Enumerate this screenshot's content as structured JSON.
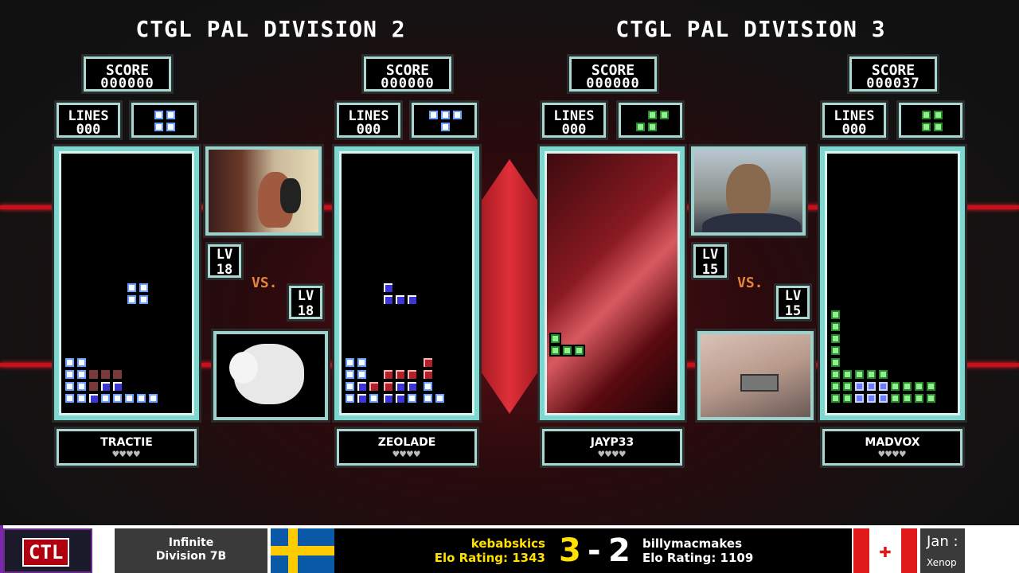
{
  "divisions": [
    {
      "title": "CTGL PAL DIVISION 2",
      "vs": "VS.",
      "players": [
        {
          "name": "TRACTIE",
          "score_label": "SCORE",
          "score": "000000",
          "lines_label": "LINES",
          "lines": "000",
          "level_label": "LV",
          "level": "18",
          "hearts": "♥♥♥♥"
        },
        {
          "name": "ZEOLADE",
          "score_label": "SCORE",
          "score": "000000",
          "lines_label": "LINES",
          "lines": "000",
          "level_label": "LV",
          "level": "18",
          "hearts": "♥♥♥♥"
        }
      ]
    },
    {
      "title": "CTGL PAL DIVISION 3",
      "vs": "VS.",
      "players": [
        {
          "name": "JAYP33",
          "score_label": "SCORE",
          "score": "000000",
          "lines_label": "LINES",
          "lines": "000",
          "level_label": "LV",
          "level": "15",
          "hearts": "♥♥♥♥"
        },
        {
          "name": "MADVOX",
          "score_label": "SCORE",
          "score": "000037",
          "lines_label": "LINES",
          "lines": "000",
          "level_label": "LV",
          "level": "15",
          "hearts": "♥♥♥♥"
        }
      ]
    }
  ],
  "bottom_bar": {
    "logo_text": "CTL",
    "division_line1": "Infinite",
    "division_line2": "Division 7B",
    "player1_name": "kebabskics",
    "player1_elo": "Elo Rating: 1343",
    "score1": "3",
    "separator": "-",
    "score2": "2",
    "player2_name": "billymacmakes",
    "player2_elo": "Elo Rating: 1109",
    "date_text": "Jan :",
    "date_sub": "Xenop",
    "colors": {
      "player1": "#ffe000",
      "accent_red": "#c8101a",
      "sweden_blue": "#0a5aa8",
      "sweden_yellow": "#fecc00",
      "canada_red": "#e01a1a"
    }
  }
}
